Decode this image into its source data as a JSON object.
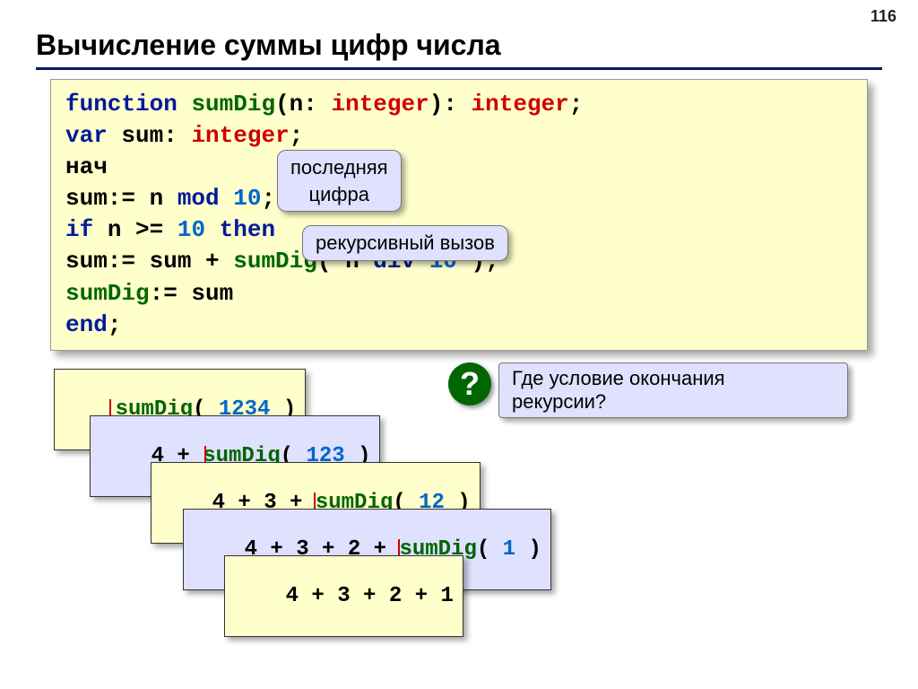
{
  "page_number": "116",
  "title": "Вычисление суммы цифр числа",
  "code": {
    "l1": {
      "kw_function": "function",
      "name": "sumDig",
      "paren_open": "(",
      "param": "n",
      "colon1": ": ",
      "t_int1": "integer",
      "paren_close": ")",
      "colon2": ": ",
      "t_int2": "integer",
      "semi": ";"
    },
    "l2": {
      "kw_var": "var",
      "sum": " sum",
      "colon": ": ",
      "t_int": "integer",
      "semi": ";"
    },
    "l3": {
      "txt": "нач"
    },
    "l4": {
      "ind": "  ",
      "lhs": "sum:= n ",
      "mod": "mod",
      "sp": " ",
      "ten": "10",
      "semi": ";"
    },
    "l5": {
      "ind": "  ",
      "kw_if": "if",
      "cond": " n >= ",
      "ten": "10",
      "sp": " ",
      "kw_then": "then"
    },
    "l6": {
      "ind": "    ",
      "a": "sum:= sum + ",
      "name": "sumDig",
      "b": "( n ",
      "div": "div",
      "sp": " ",
      "ten": "10",
      "c": " );"
    },
    "l7": {
      "ind": "  ",
      "name": "sumDig",
      ":=": ":= sum"
    },
    "l8": {
      "end": "end",
      "semi": ";"
    }
  },
  "callouts": {
    "last_digit": "последняя\nцифра",
    "recursive_call": "рекурсивный вызов",
    "question": "?",
    "question_text": "Где условие окончания\nрекурсии?"
  },
  "trace": {
    "r1": {
      "name": "sumDig",
      "open": "( ",
      "num": "1234",
      "close": " )"
    },
    "r2": {
      "a": "4 + ",
      "name": "sumDig",
      "open": "( ",
      "num": "123",
      "close": " )"
    },
    "r3": {
      "a": "4 + 3 + ",
      "name": "sumDig",
      "open": "( ",
      "num": "12",
      "close": " )"
    },
    "r4": {
      "a": "4 + 3 + 2 + ",
      "name": "sumDig",
      "open": "( ",
      "num": "1",
      "close": " )"
    },
    "r5": {
      "a": "4 + 3 + 2 + 1"
    }
  }
}
